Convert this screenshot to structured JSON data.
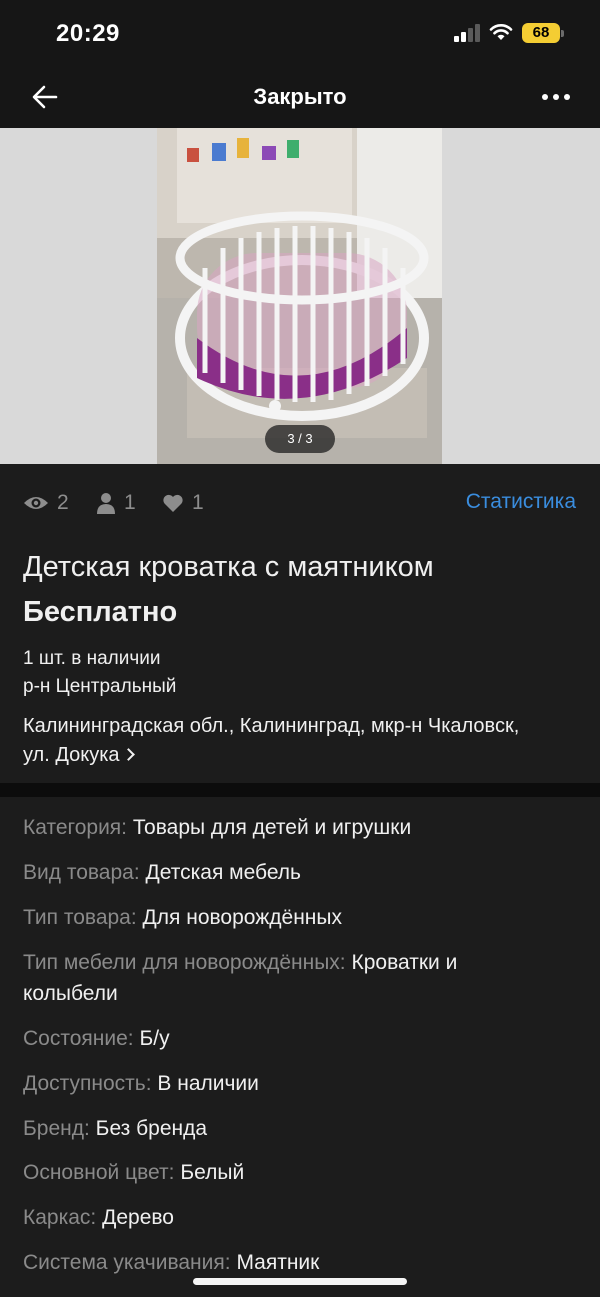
{
  "status_bar": {
    "time": "20:29",
    "battery": "68"
  },
  "nav": {
    "title": "Закрыто"
  },
  "gallery": {
    "counter": "3 / 3"
  },
  "stats": {
    "views": "2",
    "contacts": "1",
    "favorites": "1",
    "link": "Статистика"
  },
  "listing": {
    "title": "Детская кроватка с маятником",
    "price": "Бесплатно",
    "quantity": "1 шт. в наличии",
    "district": "р-н Центральный",
    "address": "Калининградская обл., Калининград, мкр-н Чкаловск, ул. Докука"
  },
  "specs": [
    {
      "key": "Категория:",
      "value": "Товары для детей и игрушки"
    },
    {
      "key": "Вид товара:",
      "value": "Детская мебель"
    },
    {
      "key": "Тип товара:",
      "value": "Для новорождённых"
    },
    {
      "key": "Тип мебели для новорождённых:",
      "value": "Кроватки и колыбели"
    },
    {
      "key": "Состояние:",
      "value": "Б/у"
    },
    {
      "key": "Доступность:",
      "value": "В наличии"
    },
    {
      "key": "Бренд:",
      "value": "Без бренда"
    },
    {
      "key": "Основной цвет:",
      "value": "Белый"
    },
    {
      "key": "Каркас:",
      "value": "Дерево"
    },
    {
      "key": "Система укачивания:",
      "value": "Маятник"
    }
  ],
  "colors": {
    "accent_link": "#3a8dde",
    "background": "#1c1c1c",
    "muted": "#8a8a8a"
  }
}
